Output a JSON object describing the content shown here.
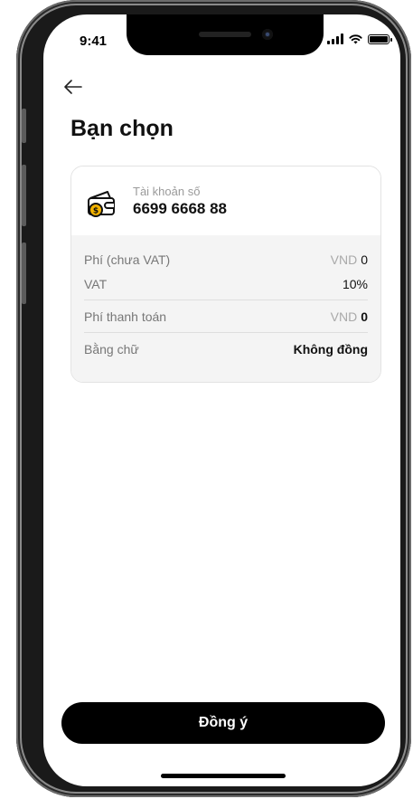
{
  "status_bar": {
    "time": "9:41"
  },
  "page": {
    "title": "Bạn chọn"
  },
  "account": {
    "label": "Tài khoản số",
    "number": "6699 6668 88"
  },
  "fees": {
    "rows": [
      {
        "label": "Phí (chưa VAT)",
        "currency": "VND",
        "value": "0"
      },
      {
        "label": "VAT",
        "value": "10%"
      },
      {
        "label": "Phí thanh toán",
        "currency": "VND",
        "value": "0"
      },
      {
        "label": "Bằng chữ",
        "value": "Không đồng"
      }
    ]
  },
  "actions": {
    "confirm_label": "Đồng ý"
  },
  "icons": {
    "back": "arrow-left-icon",
    "wallet": "wallet-coin-icon"
  },
  "colors": {
    "accent": "#000000",
    "coin": "#f5b400",
    "card_body_bg": "#f4f4f4"
  }
}
